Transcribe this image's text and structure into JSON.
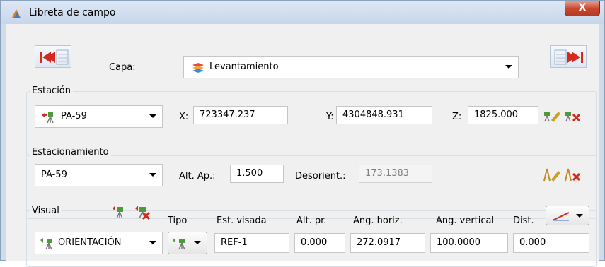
{
  "window": {
    "title": "Libreta de campo",
    "close_label": "X"
  },
  "capa": {
    "label": "Capa:",
    "value": "Levantamiento"
  },
  "estacion": {
    "group_title": "Estación",
    "station_value": "PA-59",
    "x_label": "X:",
    "x_value": "723347.237",
    "y_label": "Y:",
    "y_value": "4304848.931",
    "z_label": "Z:",
    "z_value": "1825.000"
  },
  "estacionamiento": {
    "group_title": "Estacionamiento",
    "station_value": "PA-59",
    "alt_ap_label": "Alt. Ap.:",
    "alt_ap_value": "1.500",
    "desorient_label": "Desorient.:",
    "desorient_value": "173.1383"
  },
  "visual": {
    "group_title": "Visual",
    "type_value": "ORIENTACIÓN",
    "col_tipo": "Tipo",
    "col_est_visada": "Est. visada",
    "col_alt_pr": "Alt. pr.",
    "col_ang_horiz": "Ang. horiz.",
    "col_ang_vertical": "Ang. vertical",
    "col_dist": "Dist.",
    "est_visada_value": "REF-1",
    "alt_pr_value": "0.000",
    "ang_horiz_value": "272.0917",
    "ang_vertical_value": "100.0000",
    "dist_value": "0.000"
  },
  "colors": {
    "accent_red": "#d22a1e",
    "titlebar": "#d3e0f0",
    "frame": "#cfdcec"
  }
}
